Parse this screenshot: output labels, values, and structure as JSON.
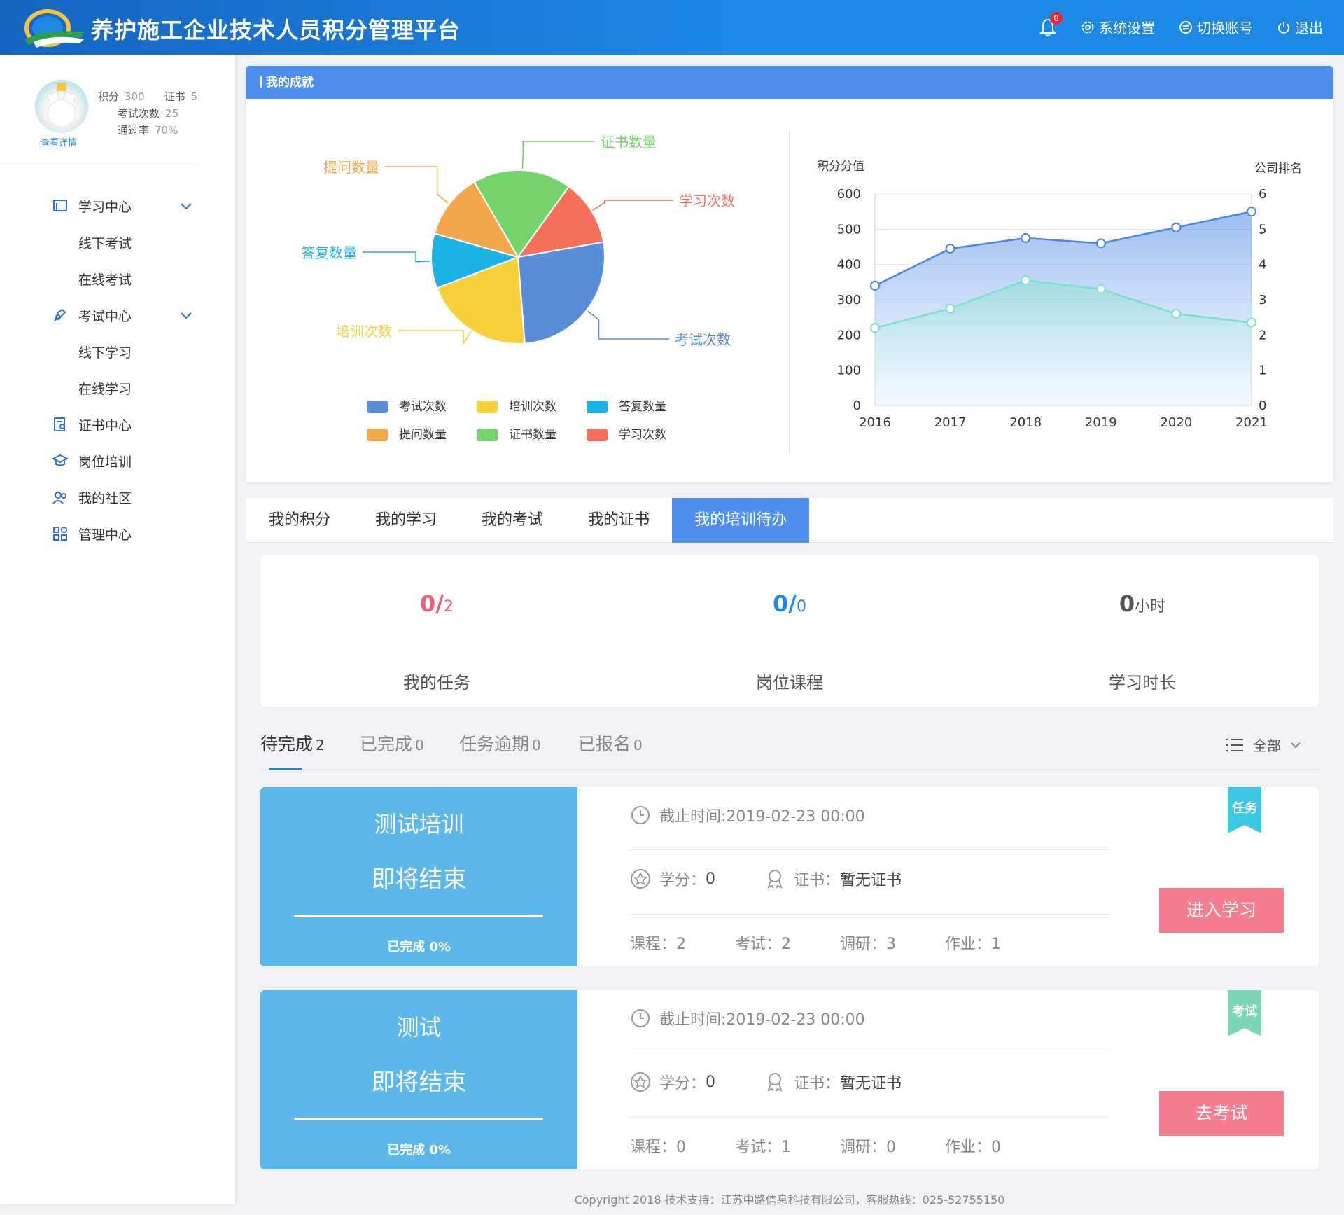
{
  "header": {
    "title": "养护施工企业技术人员积分管理平台",
    "notification_count": "0",
    "settings_label": "系统设置",
    "switch_label": "切换账号",
    "logout_label": "退出"
  },
  "profile": {
    "points_label": "积分",
    "points_value": "300",
    "certs_label": "证书",
    "certs_value": "5",
    "exams_label": "考试次数",
    "exams_value": "25",
    "pass_label": "通过率",
    "pass_value": "70%",
    "detail_link": "查看详情"
  },
  "sidebar": {
    "items": [
      {
        "label": "学习中心",
        "icon": "book-icon"
      },
      {
        "label": "线下考试"
      },
      {
        "label": "在线考试"
      },
      {
        "label": "考试中心",
        "icon": "exam-icon"
      },
      {
        "label": "线下学习"
      },
      {
        "label": "在线学习"
      },
      {
        "label": "证书中心",
        "icon": "certificate-icon"
      },
      {
        "label": "岗位培训",
        "icon": "graduation-cap-icon"
      },
      {
        "label": "我的社区",
        "icon": "community-icon"
      },
      {
        "label": "管理中心",
        "icon": "grid-icon"
      }
    ]
  },
  "achievement": {
    "title": "我的成就"
  },
  "chart_data": [
    {
      "type": "pie",
      "categories": [
        "考试次数",
        "培训次数",
        "答复数量",
        "提问数量",
        "证书数量",
        "学习次数"
      ],
      "values": [
        26,
        20,
        10,
        12,
        18,
        12
      ],
      "colors": [
        "#5b8ed9",
        "#f7d03b",
        "#1cb2e4",
        "#f4a64a",
        "#74d46b",
        "#f4705a"
      ],
      "legend": "bottom"
    },
    {
      "type": "area",
      "x": [
        "2016",
        "2017",
        "2018",
        "2019",
        "2020",
        "2021"
      ],
      "ylabel": "积分分值",
      "y2label": "公司排名",
      "ylim": [
        0,
        600
      ],
      "y2lim": [
        0,
        6
      ],
      "yticks": [
        "0",
        "100",
        "200",
        "300",
        "400",
        "500",
        "600"
      ],
      "y2ticks": [
        "0",
        "1",
        "2",
        "3",
        "4",
        "5",
        "6"
      ],
      "series": [
        {
          "values": [
            340,
            445,
            475,
            460,
            505,
            550
          ],
          "axis": "left",
          "color": "#4a86e8"
        },
        {
          "values": [
            2.2,
            2.75,
            3.55,
            3.3,
            2.6,
            2.35
          ],
          "axis": "right",
          "color": "#78e1c8"
        }
      ],
      "grid": true
    }
  ],
  "tabs": [
    "我的积分",
    "我的学习",
    "我的考试",
    "我的证书",
    "我的培训待办"
  ],
  "active_tab": "我的培训待办",
  "summary": [
    {
      "done": "0",
      "total": "2",
      "label": "我的任务",
      "color": "#f25c7a"
    },
    {
      "done": "0",
      "total": "0",
      "label": "岗位课程",
      "color": "#1e88e5"
    },
    {
      "value": "0",
      "unit": "小时",
      "label": "学习时长",
      "color": "#555555"
    }
  ],
  "filters": {
    "items": [
      {
        "label": "待完成",
        "count": "2"
      },
      {
        "label": "已完成",
        "count": "0"
      },
      {
        "label": "任务逾期",
        "count": "0"
      },
      {
        "label": "已报名",
        "count": "0"
      }
    ],
    "all_label": "全部"
  },
  "tasks": [
    {
      "name": "测试培训",
      "status": "即将结束",
      "progress": "已完成 0%",
      "deadline": "截止时间:2019-02-23 00:00",
      "credit_label": "学分：",
      "credit": "0",
      "cert_label": "证书：",
      "cert": "暂无证书",
      "courses": "课程：2",
      "exams": "考试：2",
      "surveys": "调研：3",
      "homework": "作业：1",
      "tag": "任务",
      "tag_color": "#3fc8e4",
      "button": "进入学习"
    },
    {
      "name": "测试",
      "status": "即将结束",
      "progress": "已完成 0%",
      "deadline": "截止时间:2019-02-23 00:00",
      "credit_label": "学分：",
      "credit": "0",
      "cert_label": "证书：",
      "cert": "暂无证书",
      "courses": "课程：0",
      "exams": "考试：1",
      "surveys": "调研：0",
      "homework": "作业：0",
      "tag": "考试",
      "tag_color": "#7dd6b5",
      "button": "去考试"
    }
  ],
  "footer": {
    "copyright": "Copyright 2018 技术支持：江苏中路信息科技有限公司，客服热线：025-52755150"
  }
}
